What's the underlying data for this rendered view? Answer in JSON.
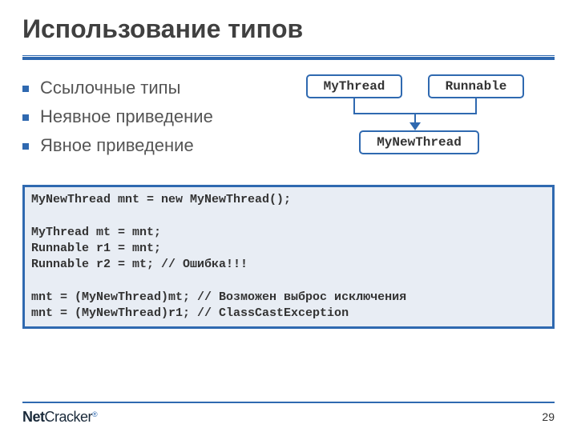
{
  "title": "Использование типов",
  "bullets": [
    "Ссылочные типы",
    "Неявное приведение",
    "Явное приведение"
  ],
  "diagram": {
    "box1": "MyThread",
    "box2": "Runnable",
    "box3": "MyNewThread"
  },
  "code": "MyNewThread mnt = new MyNewThread();\n\nMyThread mt = mnt;\nRunnable r1 = mnt;\nRunnable r2 = mt; // Ошибка!!!\n\nmnt = (MyNewThread)mt; // Возможен выброс исключения\nmnt = (MyNewThread)r1; // ClassCastException",
  "footer": {
    "logo_net": "Net",
    "logo_cracker": "Cracker",
    "logo_reg": "®",
    "page": "29"
  }
}
